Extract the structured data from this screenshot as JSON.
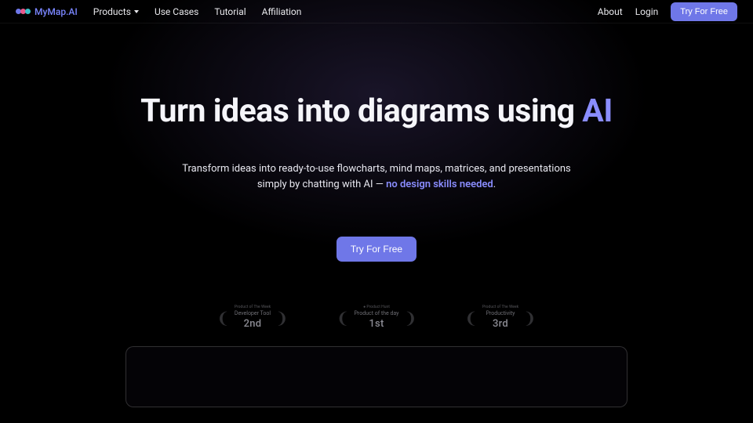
{
  "brand": {
    "name": "MyMap.AI"
  },
  "nav": {
    "left": [
      {
        "label": "Products",
        "has_dropdown": true
      },
      {
        "label": "Use Cases"
      },
      {
        "label": "Tutorial"
      },
      {
        "label": "Affiliation"
      }
    ],
    "right": [
      {
        "label": "About"
      },
      {
        "label": "Login"
      }
    ],
    "cta": "Try For Free"
  },
  "hero": {
    "title_plain": "Turn ideas into diagrams using ",
    "title_accent": "AI",
    "sub_line1": "Transform ideas into ready-to-use flowcharts, mind maps, matrices, and presentations",
    "sub_line2a": "simply by chatting with AI — ",
    "sub_highlight": "no design skills needed",
    "sub_line2b": ".",
    "cta": "Try For Free"
  },
  "awards": [
    {
      "top": "Product of The Week",
      "mid": "Developer Tool",
      "rank": "2nd"
    },
    {
      "top": "● Product Hunt",
      "mid": "Product of the day",
      "rank": "1st"
    },
    {
      "top": "Product of The Week",
      "mid": "Productivity",
      "rank": "3rd"
    }
  ],
  "colors": {
    "accent": "#6f77e8",
    "accent_text": "#8a8dff"
  },
  "logo_dots": [
    "#6f77e8",
    "#e85a8a",
    "#3ac0c8"
  ]
}
